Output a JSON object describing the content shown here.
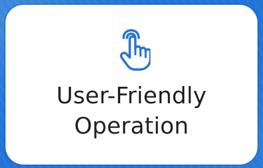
{
  "background": {
    "color": "#1f74d6"
  },
  "card": {
    "icon": "pointer-hand-icon",
    "icon_color": "#2a73d8",
    "title_line_1": "User-Friendly",
    "title_line_2": "Operation",
    "title_color": "#1f1f1f"
  }
}
